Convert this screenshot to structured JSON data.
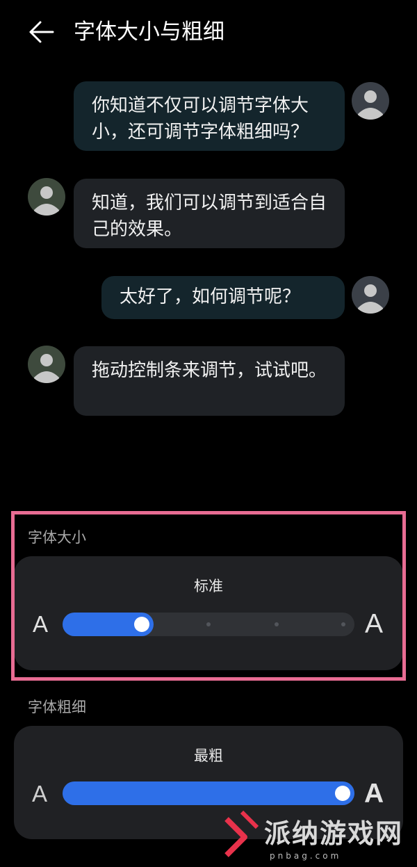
{
  "header": {
    "title": "字体大小与粗细",
    "back_icon": "arrow-left-icon"
  },
  "chat": {
    "messages": [
      {
        "side": "right",
        "text": "你知道不仅可以调节字体大小，还可调节字体粗细吗？"
      },
      {
        "side": "left",
        "text": "知道，我们可以调节到适合自己的效果。"
      },
      {
        "side": "right",
        "text": "太好了，如何调节呢？"
      },
      {
        "side": "left",
        "text": "拖动控制条来调节，试试吧。"
      }
    ]
  },
  "font_size": {
    "section_label": "字体大小",
    "value_label": "标准",
    "small_a": "A",
    "large_a": "A",
    "level": 1,
    "steps": 5
  },
  "font_weight": {
    "section_label": "字体粗细",
    "value_label": "最粗",
    "small_a": "A",
    "large_a": "A",
    "level_fraction": 1.0
  },
  "watermark": {
    "text": "派纳游戏网",
    "sub": "pnbag.com"
  },
  "colors": {
    "background": "#000000",
    "accent": "#2e6fe8",
    "card": "#202124",
    "highlight_border": "#e86c93",
    "bubble_mine": "#14252c",
    "bubble_other": "#1f2226"
  }
}
